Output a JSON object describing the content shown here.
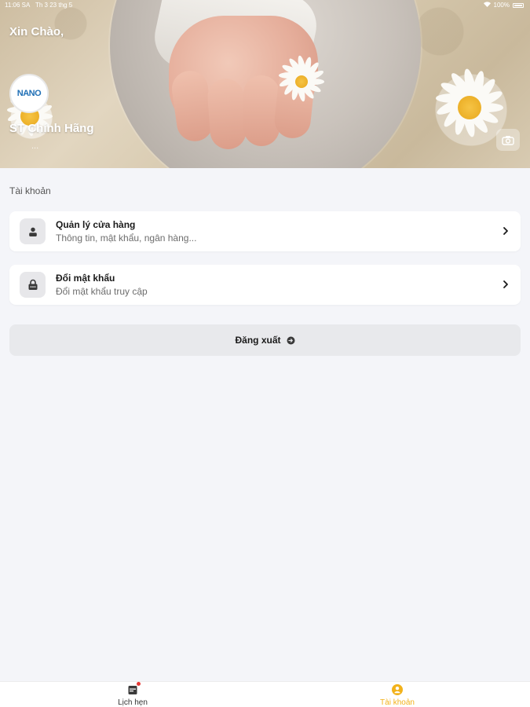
{
  "status_bar": {
    "time": "11:06 SA",
    "date": "Th 3 23 thg 5",
    "battery": "100%"
  },
  "header": {
    "greeting": "Xin Chào,",
    "logo_text": "NANO",
    "shop_name": "ST Chính Hãng",
    "shop_sub": "...",
    "camera_icon": "camera-icon"
  },
  "account": {
    "section_title": "Tài khoản",
    "items": [
      {
        "title": "Quản lý cửa hàng",
        "subtitle": "Thông tin, mật khẩu, ngân hàng...",
        "icon": "store-user-icon"
      },
      {
        "title": "Đổi mật khẩu",
        "subtitle": "Đổi mật khẩu truy cập",
        "icon": "lock-icon"
      }
    ],
    "logout_label": "Đăng xuất"
  },
  "tabs": [
    {
      "label": "Lịch hẹn",
      "icon": "calendar-icon",
      "active": false,
      "badge": true
    },
    {
      "label": "Tài khoản",
      "icon": "user-icon",
      "active": true
    }
  ],
  "colors": {
    "accent": "#f2b21a",
    "background": "#f4f5f9",
    "card": "#ffffff"
  }
}
